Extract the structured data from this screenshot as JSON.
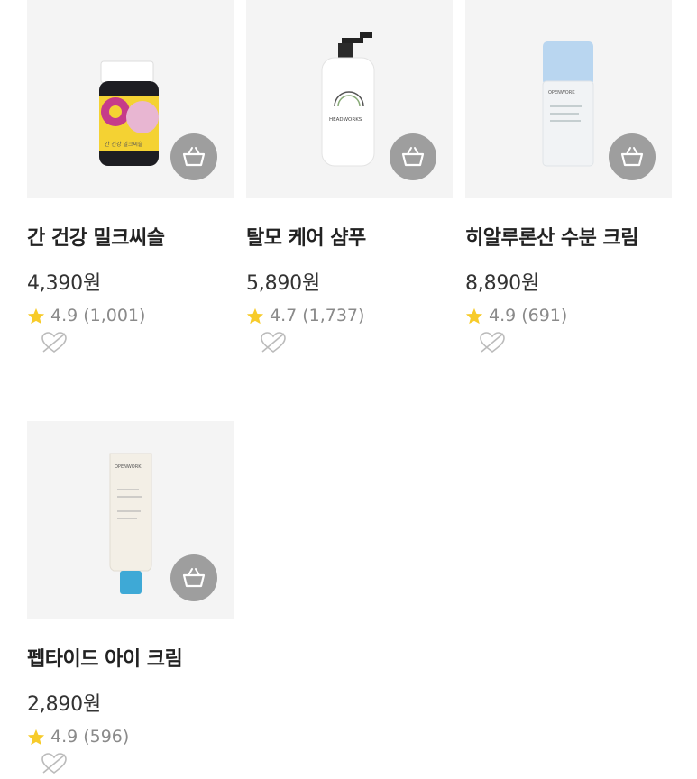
{
  "products": [
    {
      "name": "간 건강 밀크씨슬",
      "price": "4,390원",
      "rating": "4.9",
      "review_count": "(1,001)",
      "image": "milk-thistle-supplement-bottle",
      "label_text": "간 건강 밀크씨슬"
    },
    {
      "name": "탈모 케어 샴푸",
      "price": "5,890원",
      "rating": "4.7",
      "review_count": "(1,737)",
      "image": "hair-loss-shampoo-pump-bottle",
      "label_text": "HEADWORKS"
    },
    {
      "name": "히알루론산 수분 크림",
      "price": "8,890원",
      "rating": "4.9",
      "review_count": "(691)",
      "image": "hyaluronic-cream-tube",
      "label_text": "OPENWORK"
    },
    {
      "name": "펩타이드 아이 크림",
      "price": "2,890원",
      "rating": "4.9",
      "review_count": "(596)",
      "image": "peptide-eye-cream-tube",
      "label_text": "OPENWORK"
    }
  ],
  "colors": {
    "star": "#f7cb2a",
    "cart_button": "#9e9e9e",
    "thumb_bg": "#f4f4f4"
  },
  "icons": {
    "cart": "shopping-basket-icon",
    "rating": "star-icon",
    "no_like": "no-heart-icon"
  }
}
